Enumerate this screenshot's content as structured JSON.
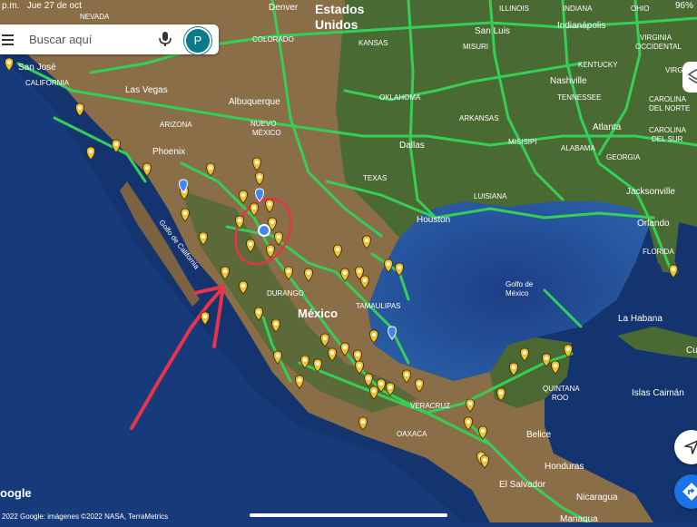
{
  "status_bar": {
    "time": "p.m.",
    "date": "Jue 27 de oct",
    "battery": "96%"
  },
  "search": {
    "placeholder": "Buscar aquí",
    "avatar_letter": "P"
  },
  "map_labels": {
    "countries": [
      "Estados",
      "Unidos",
      "México"
    ],
    "states": [
      "NEVADA",
      "COLORADO",
      "KANSAS",
      "MISURI",
      "ILLINOIS",
      "INDIANA",
      "OHIO",
      "VIRGINIA",
      "OCCIDENTAL",
      "VIRGINIA",
      "CALIFORNIA",
      "ARIZONA",
      "NUEVO",
      "MÉXICO",
      "OKLAHOMA",
      "ARKANSAS",
      "TENNESSEE",
      "KENTUCKY",
      "CAROLINA",
      "DEL NORTE",
      "CAROLINA",
      "DEL SUR",
      "GEORGIA",
      "ALABAMA",
      "MISISIPI",
      "TEXAS",
      "LUISIANA",
      "FLORIDA",
      "DURANGO",
      "TAMAULIPAS",
      "VERACRUZ",
      "OAXACA",
      "QUINTANA",
      "ROO"
    ],
    "cities": [
      "Denver",
      "San Luis",
      "Indianápolis",
      "San José",
      "Las Vegas",
      "Albuquerque",
      "Phoenix",
      "Nashville",
      "Atlanta",
      "Dallas",
      "Houston",
      "Jacksonville",
      "Orlando",
      "Belice",
      "Honduras",
      "El Salvador",
      "Nicaragua",
      "Managua",
      "La Habana",
      "Islas Caimán",
      "Cuba"
    ],
    "water": [
      "Golfo de",
      "México",
      "Golfo de California"
    ]
  },
  "attribution": "2022 Google: imágenes ©2022 NASA, TerraMetrics",
  "logo_text": "oogle",
  "colors": {
    "ocean_deep": "#12306b",
    "ocean_shelf": "#2b5fa8",
    "land_dry": "#9a7a52",
    "land_green": "#4f6a34",
    "road": "#3bd15a",
    "marker": "#f2c230",
    "annotation": "#e8334a",
    "my_location": "#4285f4"
  },
  "icons": [
    "menu-icon",
    "mic-icon",
    "layers-icon",
    "compass-icon",
    "directions-icon",
    "location-pin-icon"
  ]
}
